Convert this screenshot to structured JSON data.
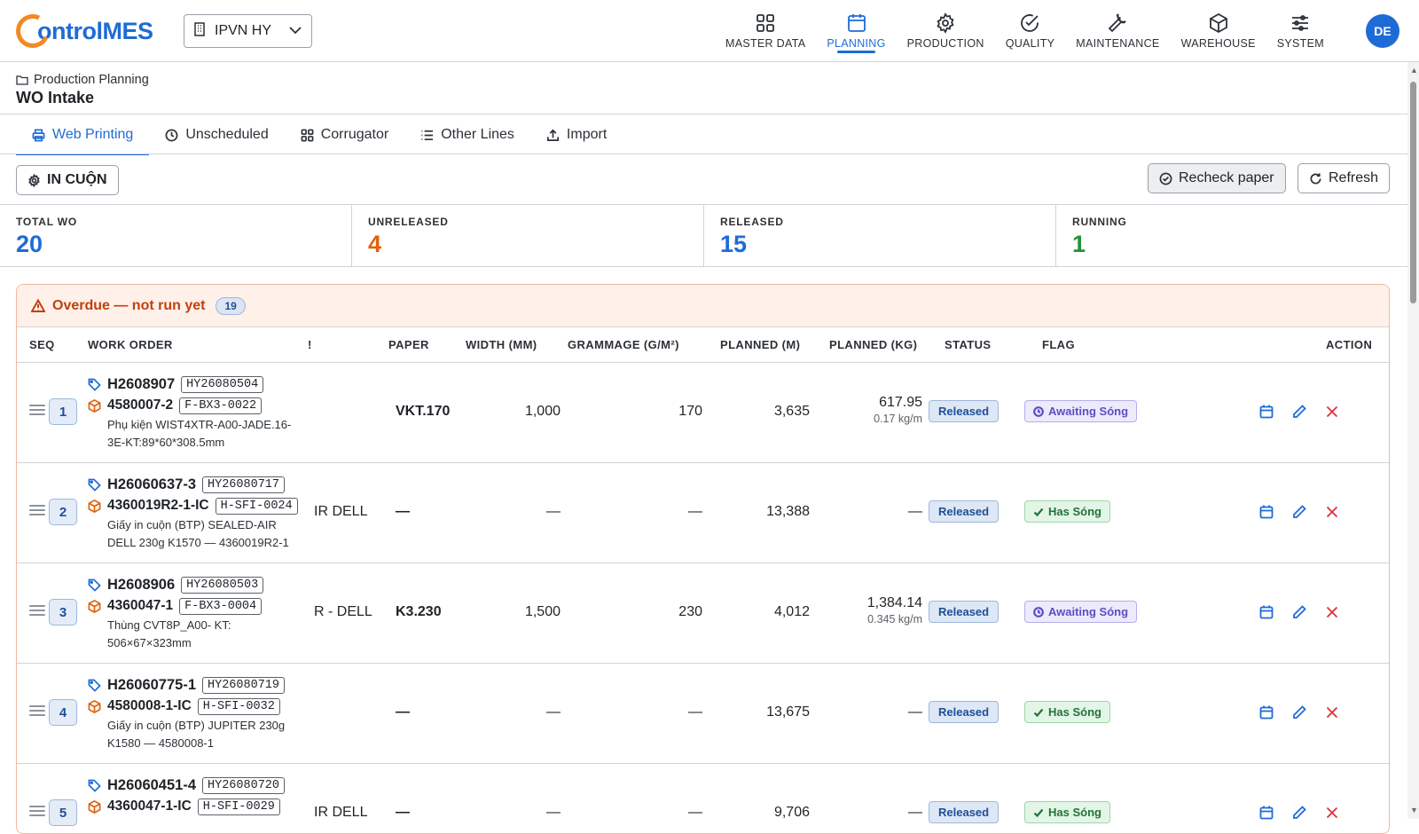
{
  "brand": {
    "name": "ontrolMES",
    "accent": "#1f6bd6",
    "logo_accent": "#f08a24"
  },
  "site_selector": {
    "value": "IPVN HY",
    "icon": "building-icon"
  },
  "nav": [
    {
      "label": "MASTER DATA",
      "icon": "grid-icon"
    },
    {
      "label": "PLANNING",
      "icon": "calendar-icon",
      "active": true
    },
    {
      "label": "PRODUCTION",
      "icon": "gear-icon"
    },
    {
      "label": "QUALITY",
      "icon": "check-circle-icon"
    },
    {
      "label": "MAINTENANCE",
      "icon": "wrench-icon"
    },
    {
      "label": "WAREHOUSE",
      "icon": "box-icon"
    },
    {
      "label": "SYSTEM",
      "icon": "sliders-icon"
    }
  ],
  "user": {
    "initials": "DE"
  },
  "breadcrumb": {
    "parent": "Production Planning",
    "title": "WO Intake"
  },
  "tabs": [
    {
      "label": "Web Printing",
      "icon": "printer-icon",
      "active": true
    },
    {
      "label": "Unscheduled",
      "icon": "clock-icon"
    },
    {
      "label": "Corrugator",
      "icon": "grid-icon"
    },
    {
      "label": "Other Lines",
      "icon": "list-icon"
    },
    {
      "label": "Import",
      "icon": "upload-icon"
    }
  ],
  "toolbar": {
    "line_button": "IN CUỘN",
    "recheck": "Recheck paper",
    "refresh": "Refresh"
  },
  "stats": [
    {
      "label": "TOTAL WO",
      "value": "20",
      "color": "#1f6bd6"
    },
    {
      "label": "UNRELEASED",
      "value": "4",
      "color": "#e0620d"
    },
    {
      "label": "RELEASED",
      "value": "15",
      "color": "#1f6bd6"
    },
    {
      "label": "RUNNING",
      "value": "1",
      "color": "#23933a"
    }
  ],
  "overdue": {
    "title": "Overdue — not run yet",
    "count": "19"
  },
  "columns": {
    "seq": "SEQ",
    "work_order": "WORK ORDER",
    "customer": "!",
    "paper": "PAPER",
    "width": "WIDTH (MM)",
    "grammage": "GRAMMAGE (G/M²)",
    "planned_m": "PLANNED (M)",
    "planned_kg": "PLANNED (KG)",
    "status": "STATUS",
    "flag": "FLAG",
    "action": "ACTION"
  },
  "rows": [
    {
      "seq": "1",
      "wo": "H2608907",
      "wo_code": "HY26080504",
      "product": "4580007-2",
      "product_code": "F-BX3-0022",
      "desc": "Phụ kiện WIST4XTR-A00-JADE.16-3E-KT:89*60*308.5mm",
      "customer": "",
      "paper": "VKT.170",
      "width": "1,000",
      "grammage": "170",
      "planned_m": "3,635",
      "planned_kg": "617.95",
      "kg_per_m": "0.17 kg/m",
      "status": "Released",
      "flag": "Awaiting Sóng",
      "flag_type": "await"
    },
    {
      "seq": "2",
      "wo": "H26060637-3",
      "wo_code": "HY26080717",
      "product": "4360019R2-1-IC",
      "product_code": "H-SFI-0024",
      "desc": "Giấy in cuộn (BTP) SEALED-AIR DELL 230g K1570 — 4360019R2-1",
      "customer": "IR DELL",
      "paper": "—",
      "width": "—",
      "grammage": "—",
      "planned_m": "13,388",
      "planned_kg": "—",
      "kg_per_m": "",
      "status": "Released",
      "flag": "Has Sóng",
      "flag_type": "has"
    },
    {
      "seq": "3",
      "wo": "H2608906",
      "wo_code": "HY26080503",
      "product": "4360047-1",
      "product_code": "F-BX3-0004",
      "desc": "Thùng CVT8P_A00- KT: 506×67×323mm",
      "customer": "R - DELL",
      "paper": "K3.230",
      "width": "1,500",
      "grammage": "230",
      "planned_m": "4,012",
      "planned_kg": "1,384.14",
      "kg_per_m": "0.345 kg/m",
      "status": "Released",
      "flag": "Awaiting Sóng",
      "flag_type": "await"
    },
    {
      "seq": "4",
      "wo": "H26060775-1",
      "wo_code": "HY26080719",
      "product": "4580008-1-IC",
      "product_code": "H-SFI-0032",
      "desc": "Giấy in cuộn (BTP) JUPITER 230g K1580 — 4580008-1",
      "customer": "",
      "paper": "—",
      "width": "—",
      "grammage": "—",
      "planned_m": "13,675",
      "planned_kg": "—",
      "kg_per_m": "",
      "status": "Released",
      "flag": "Has Sóng",
      "flag_type": "has"
    },
    {
      "seq": "5",
      "wo": "H26060451-4",
      "wo_code": "HY26080720",
      "product": "4360047-1-IC",
      "product_code": "H-SFI-0029",
      "desc": "",
      "customer": "IR DELL",
      "paper": "—",
      "width": "—",
      "grammage": "—",
      "planned_m": "9,706",
      "planned_kg": "—",
      "kg_per_m": "",
      "status": "Released",
      "flag": "Has Sóng",
      "flag_type": "has"
    }
  ]
}
